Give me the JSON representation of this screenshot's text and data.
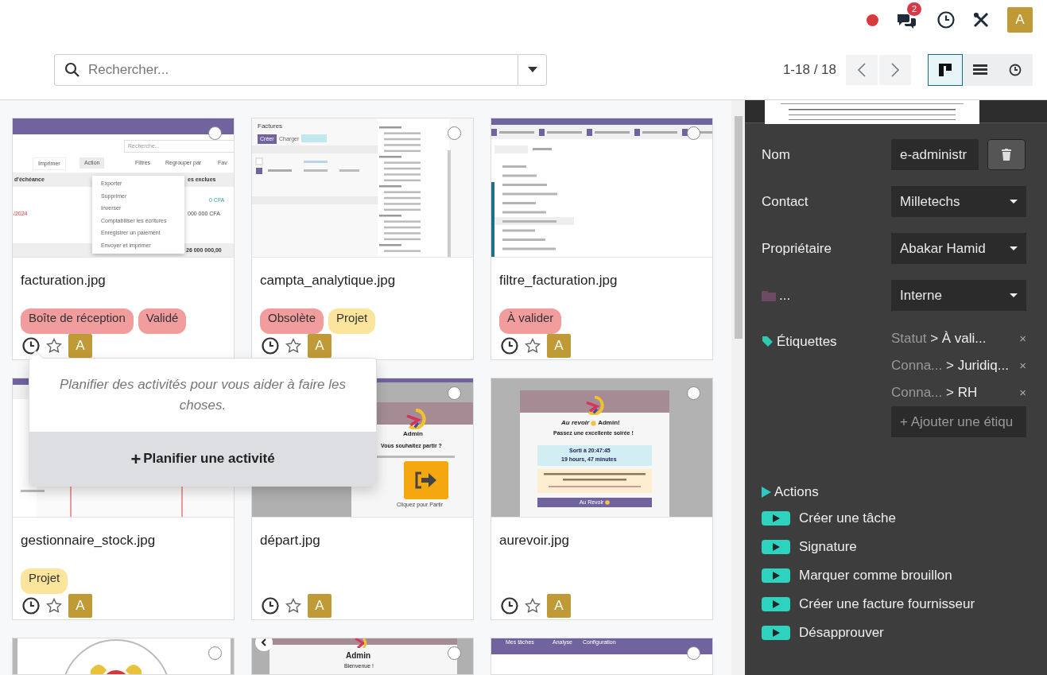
{
  "systray": {
    "chat_badge": "2",
    "avatar": "A",
    "recording": true
  },
  "search": {
    "placeholder": "Rechercher..."
  },
  "pager": {
    "range": "1-18 / 18"
  },
  "view_switcher": [
    {
      "kind": "kanban",
      "selected": true
    },
    {
      "kind": "list",
      "selected": false
    },
    {
      "kind": "activity",
      "selected": false
    }
  ],
  "cards": [
    {
      "name": "facturation.jpg",
      "selected": false,
      "favorite": false,
      "avatar": "A",
      "tags": [
        {
          "label": "Boîte de réception",
          "color": "#f29d9d"
        },
        {
          "label": "Validé",
          "color": "#f29d9d"
        }
      ],
      "thumbnail": {
        "kind": "invoice_list",
        "search": "Recherche...",
        "buttons": [
          "Imprimer",
          "Action",
          "Filtres",
          "Regrouper par",
          "Fav"
        ],
        "columns": [
          "d'échéance",
          "es exclues"
        ],
        "cells": [
          "0 CFA",
          "/2024",
          "000 000 CFA"
        ],
        "total": "26 000 000,00",
        "menu": [
          "Exporter",
          "Supprimer",
          "Inverser",
          "Comptabiliser les écritures",
          "Enregistrer un paiement",
          "Envoyer et imprimer"
        ]
      }
    },
    {
      "name": "campta_analytique.jpg",
      "selected": false,
      "favorite": false,
      "avatar": "A",
      "tags": [
        {
          "label": "Obsolète",
          "color": "#f29d9d"
        },
        {
          "label": "Projet",
          "color": "#fbe59c"
        }
      ],
      "thumbnail": {
        "kind": "invoice_menu",
        "title": "Factures",
        "buttons": [
          "Créer",
          "Charger"
        ]
      }
    },
    {
      "name": "filtre_facturation.jpg",
      "selected": false,
      "favorite": false,
      "avatar": "A",
      "tags": [
        {
          "label": "À valider",
          "color": "#f29d9d"
        }
      ],
      "thumbnail": {
        "kind": "filter_menu"
      }
    },
    {
      "name": "gestionnaire_stock.jpg",
      "favorite": false,
      "avatar": "A",
      "tags": [
        {
          "label": "Projet",
          "color": "#fbe59c"
        }
      ],
      "thumbnail": {
        "kind": "covered"
      }
    },
    {
      "name": "départ.jpg",
      "selected": false,
      "favorite": false,
      "avatar": "A",
      "thumbnail": {
        "kind": "checkout",
        "user": "Admin",
        "question": "Vous souhaitez partir ?",
        "hint": "Cliquez pour Partir"
      }
    },
    {
      "name": "aurevoir.jpg",
      "selected": false,
      "favorite": false,
      "avatar": "A",
      "thumbnail": {
        "kind": "goodbye",
        "greeting": "Au revoir",
        "user": "Admin!",
        "subtitle": "Passez une excellente soirée !",
        "time": "Sorti à 20:47:45",
        "duration": "19 hours, 47 minutes",
        "button": "Au Revoir"
      }
    },
    {
      "selected": false,
      "thumbnail": {
        "kind": "emblem"
      }
    },
    {
      "selected": false,
      "thumbnail": {
        "kind": "welcome",
        "user": "Admin",
        "subtitle": "Bienvenue !"
      }
    },
    {
      "selected": false,
      "thumbnail": {
        "kind": "menu_bar",
        "menu": [
          "Mes tâches",
          "Analyse",
          "Configuration"
        ]
      }
    }
  ],
  "popover": {
    "text": "Planifier des activités pour vous aider à faire les choses.",
    "button_icon": "+",
    "button": "Planifier une activité"
  },
  "details": {
    "fields": [
      {
        "kind": "text",
        "label": "Nom",
        "value": "e-administr"
      },
      {
        "kind": "select",
        "label": "Contact",
        "value": "Milletechs"
      },
      {
        "kind": "select",
        "label": "Propriétaire",
        "value": "Abakar Hamid"
      },
      {
        "kind": "folder",
        "label": "...",
        "value": "Interne"
      }
    ],
    "tags_label": "Étiquettes",
    "tags": [
      {
        "facet": "Statut",
        "value": "> À vali...",
        "remove": "×"
      },
      {
        "facet": "Conna...",
        "value": "> Juridiq...",
        "remove": "×"
      },
      {
        "facet": "Conna...",
        "value": "> RH",
        "remove": "×"
      }
    ],
    "tag_placeholder": "+ Ajouter une étiqu",
    "actions_label": "Actions",
    "actions": [
      "Créer une tâche",
      "Signature",
      "Marquer comme brouillon",
      "Créer une facture fournisseur",
      "Désapprouver"
    ]
  }
}
